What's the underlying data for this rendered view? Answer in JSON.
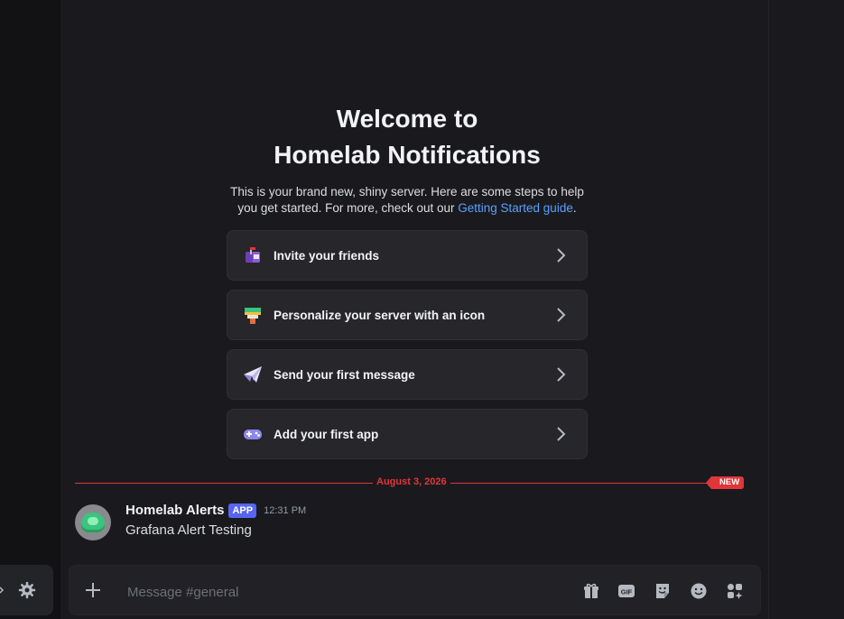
{
  "welcome": {
    "title_line1": "Welcome to",
    "title_line2": "Homelab Notifications",
    "subtitle": "This is your brand new, shiny server. Here are some steps to help you get started. For more, check out our ",
    "guide_link": "Getting Started guide",
    "subtitle_end": "."
  },
  "cards": [
    {
      "label": "Invite your friends",
      "icon": "mailbox-icon"
    },
    {
      "label": "Personalize your server with an icon",
      "icon": "paint-brush-icon"
    },
    {
      "label": "Send your first message",
      "icon": "paper-plane-icon"
    },
    {
      "label": "Add your first app",
      "icon": "gamepad-icon"
    }
  ],
  "divider": {
    "date": "August 3, 2026",
    "new_label": "NEW"
  },
  "message": {
    "username": "Homelab Alerts",
    "tag": "APP",
    "timestamp": "12:31 PM",
    "text": "Grafana Alert Testing"
  },
  "composer": {
    "placeholder": "Message #general"
  },
  "colors": {
    "accent": "#5865f2",
    "link": "#5aa0ff",
    "new": "#e0363a",
    "background": "#1a1a1e"
  }
}
